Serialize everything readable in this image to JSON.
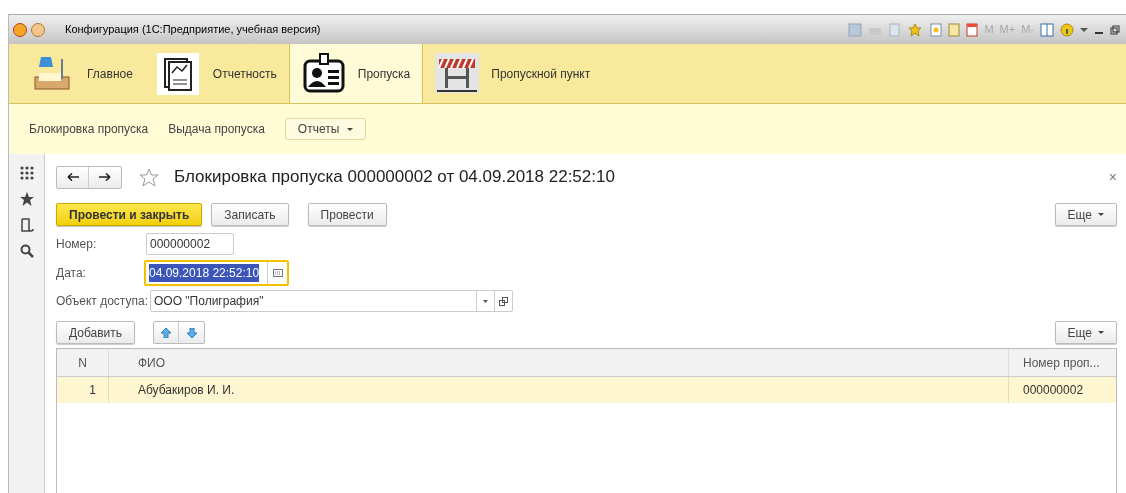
{
  "window": {
    "title": "Конфигурация  (1С:Предприятие, учебная версия)",
    "memory_buttons": [
      "M",
      "M+",
      "M-"
    ]
  },
  "sections": [
    {
      "label": "Главное",
      "selected": false
    },
    {
      "label": "Отчетность",
      "selected": false
    },
    {
      "label": "Пропуска",
      "selected": true
    },
    {
      "label": "Пропускной пункт",
      "selected": false
    }
  ],
  "nav": {
    "links": [
      "Блокировка пропуска",
      "Выдача пропуска"
    ],
    "menu_button": "Отчеты"
  },
  "form": {
    "title": "Блокировка пропуска 000000002 от 04.09.2018 22:52:10",
    "close": "×",
    "buttons": [
      {
        "label": "Провести и закрыть",
        "kind": "primary"
      },
      {
        "label": "Записать",
        "kind": "normal"
      },
      {
        "label": "Провести",
        "kind": "normal"
      }
    ],
    "more_button": "Еще",
    "fields": [
      {
        "label": "Номер:",
        "value": "000000002",
        "kind": "text",
        "focused": false
      },
      {
        "label": "Дата:",
        "value": "04.09.2018 22:52:10",
        "kind": "date",
        "focused": true
      },
      {
        "label": "Объект доступа:",
        "value": "ООО \"Полиграфия\"",
        "kind": "choice",
        "focused": false
      }
    ],
    "table_toolbar": {
      "add_button": "Добавить",
      "more_button": "Еще"
    },
    "table": {
      "columns": [
        "N",
        "ФИО",
        "Номер проп..."
      ],
      "rows": [
        {
          "cells": [
            "1",
            "Абубакиров И. И.",
            "000000002"
          ],
          "selected": true
        }
      ]
    }
  }
}
